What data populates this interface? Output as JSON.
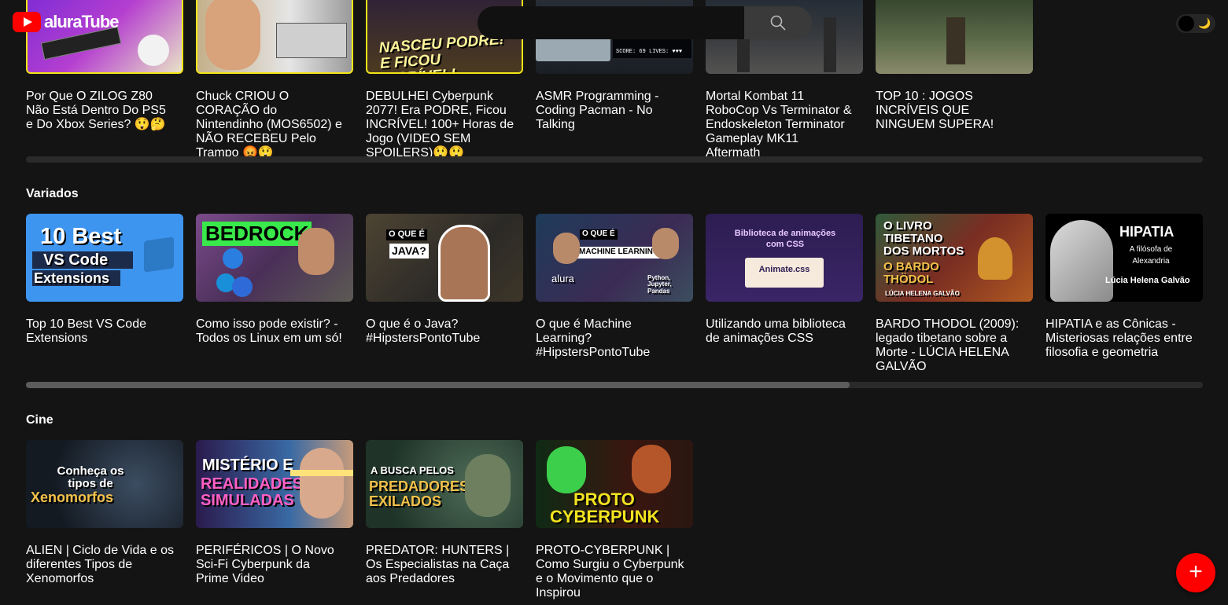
{
  "app": {
    "logo_text": "aluraTube"
  },
  "search": {
    "placeholder": "",
    "value": ""
  },
  "theme": {
    "moon": "🌙",
    "mode": "dark"
  },
  "rows": [
    {
      "title": "",
      "videos": [
        {
          "title": "Por Que O ZILOG Z80 Não Está Dentro Do PS5 e Do Xbox Series? 😲🤔"
        },
        {
          "title": "Chuck CRIOU O CORAÇÃO do Nintendinho (MOS6502) e NÃO RECEBEU Pelo Trampo 😡😲"
        },
        {
          "title": "DEBULHEI Cyberpunk 2077! Era PODRE, Ficou INCRÍVEL! 100+ Horas de Jogo (VIDEO SEM SPOILERS)😲😲",
          "thumb_text": "NASCEU PODRE! E FICOU INCRÍVEL!"
        },
        {
          "title": "ASMR Programming - Coding Pacman - No Talking",
          "thumb_text": "SCORE: 69 LIVES: ♥♥♥"
        },
        {
          "title": "Mortal Kombat 11 RoboCop Vs Terminator & Endoskeleton Terminator Gameplay MK11 Aftermath"
        },
        {
          "title": "TOP 10 : JOGOS INCRÍVEIS QUE NINGUEM SUPERA!"
        }
      ]
    },
    {
      "title": "Variados",
      "videos": [
        {
          "title": "Top 10 Best VS Code Extensions",
          "thumb_text": [
            "10 Best",
            "VS Code",
            "Extensions"
          ]
        },
        {
          "title": "Como isso pode existir? - Todos os Linux em um só!",
          "thumb_text": "BEDROCK"
        },
        {
          "title": "O que é o Java? #HipstersPontoTube",
          "thumb_text": [
            "O QUE É",
            "JAVA?"
          ]
        },
        {
          "title": "O que é Machine Learning? #HipstersPontoTube",
          "thumb_text": [
            "O QUE É",
            "MACHINE LEARNING?",
            "alura",
            "Python, Jupyter, Pandas"
          ]
        },
        {
          "title": "Utilizando uma biblioteca de animações CSS",
          "thumb_text": [
            "Biblioteca de animações com CSS",
            "Animate.css"
          ]
        },
        {
          "title": "BARDO THODOL (2009): legado tibetano sobre a Morte - LÚCIA HELENA GALVÃO",
          "thumb_text": [
            "O LIVRO TIBETANO DOS MORTOS",
            "O BARDO THÖDOL",
            "LÚCIA HELENA GALVÃO"
          ]
        },
        {
          "title": "HIPATIA e as Cônicas - Misteriosas relações entre filosofia e geometria",
          "thumb_text": [
            "HIPATIA",
            "A filósofa de Alexandria",
            "Lúcia Helena Galvão"
          ]
        }
      ],
      "scroll_fraction": 0.7
    },
    {
      "title": "Cine",
      "videos": [
        {
          "title": "ALIEN | Ciclo de Vida e os diferentes Tipos de Xenomorfos",
          "thumb_text": [
            "Conheça os tipos de",
            "Xenomorfos"
          ]
        },
        {
          "title": "PERIFÉRICOS | O Novo Sci-Fi Cyberpunk da Prime Video",
          "thumb_text": [
            "MISTÉRIO E",
            "REALIDADES SIMULADAS"
          ]
        },
        {
          "title": "PREDATOR: HUNTERS | Os Especialistas na Caça aos Predadores",
          "thumb_text": [
            "A BUSCA PELOS",
            "PREDADORES EXILADOS"
          ]
        },
        {
          "title": "PROTO-CYBERPUNK | Como Surgiu o Cyberpunk e o Movimento que o Inspirou",
          "thumb_text": [
            "PROTO",
            "CYBERPUNK"
          ]
        }
      ]
    }
  ],
  "fab": {
    "label": "+"
  },
  "colors": {
    "accent": "#ff0000",
    "background": "#141414"
  }
}
